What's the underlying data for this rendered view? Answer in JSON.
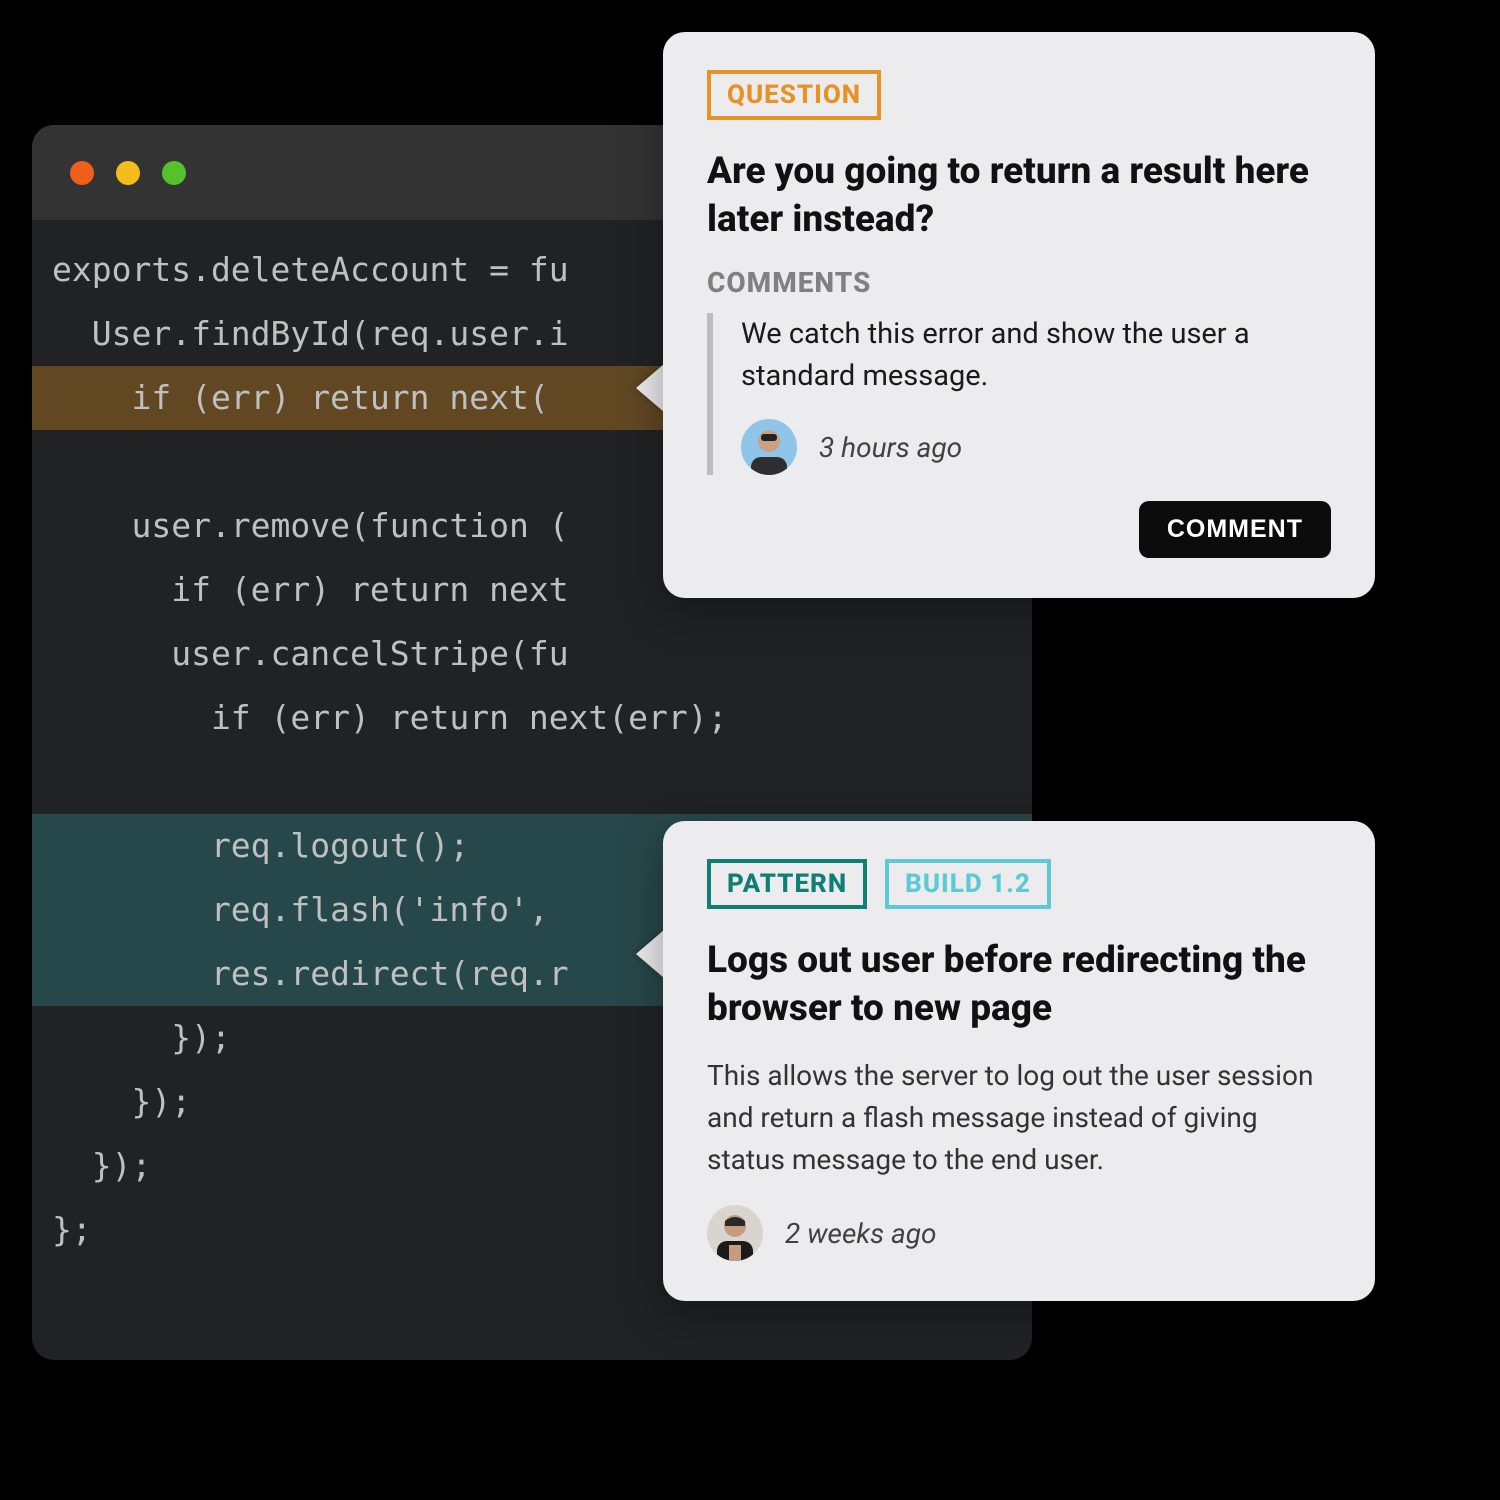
{
  "editor": {
    "traffic_lights": [
      "#ee5f1a",
      "#f5bd19",
      "#54c22b"
    ],
    "lines": [
      {
        "text": "exports.deleteAccount = fu",
        "hl": null
      },
      {
        "text": "  User.findById(req.user.i",
        "hl": null
      },
      {
        "text": "    if (err) return next(",
        "hl": "amber"
      },
      {
        "text": "",
        "hl": null
      },
      {
        "text": "    user.remove(function (",
        "hl": null
      },
      {
        "text": "      if (err) return next",
        "hl": null
      },
      {
        "text": "      user.cancelStripe(fu",
        "hl": null
      },
      {
        "text": "        if (err) return next(err);",
        "hl": null
      },
      {
        "text": "",
        "hl": null
      },
      {
        "text": "        req.logout();",
        "hl": "teal"
      },
      {
        "text": "        req.flash('info',",
        "hl": "teal"
      },
      {
        "text": "        res.redirect(req.r",
        "hl": "teal"
      },
      {
        "text": "      });",
        "hl": null
      },
      {
        "text": "    });",
        "hl": null
      },
      {
        "text": "  });",
        "hl": null
      },
      {
        "text": "};",
        "hl": null
      }
    ]
  },
  "card_question": {
    "tag_label": "QUESTION",
    "tag_color": "#e69225",
    "title": "Are you going to return a result here later instead?",
    "comments_label": "COMMENTS",
    "comment_text": "We catch this error and show the user a standard message.",
    "timestamp": "3 hours ago",
    "button_label": "COMMENT"
  },
  "card_pattern": {
    "tag1_label": "PATTERN",
    "tag1_color": "#0f7f76",
    "tag2_label": "BUILD 1.2",
    "tag2_color": "#5dc9d5",
    "title": "Logs out user before redirecting the browser to new page",
    "body": "This allows the server to log out the user session and return a flash message instead of giving status message to the end user.",
    "timestamp": "2 weeks ago"
  }
}
